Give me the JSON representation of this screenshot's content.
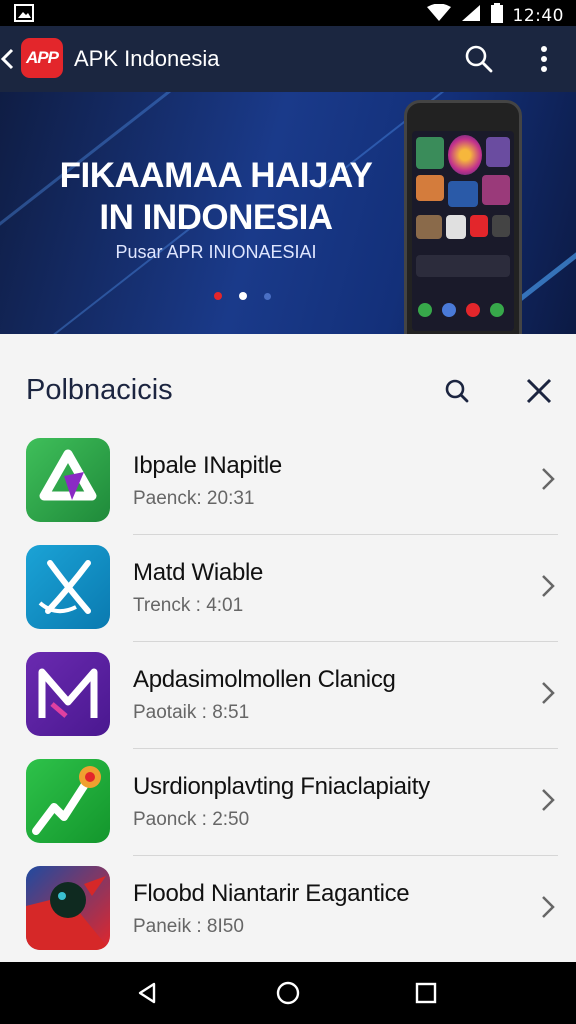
{
  "status_bar": {
    "time": "12:40"
  },
  "app_bar": {
    "logo_text": "APP",
    "title": "APK Indonesia"
  },
  "banner": {
    "headline_line1": "FIKAAMAA HAIJAY",
    "headline_line2": "IN INDONESIA",
    "subtitle": "Pusar APR INIONAESIAI",
    "slides": 3,
    "active_slide": 2
  },
  "list": {
    "heading": "Polbnacicis",
    "items": [
      {
        "name": "Ibpale INapitle",
        "meta": "Paenck: 20:31",
        "icon": "green-arrow-app-icon"
      },
      {
        "name": "Matd Wiable",
        "meta": "Trenck : 4:01",
        "icon": "blue-x-app-icon"
      },
      {
        "name": "Apdasimolmollen Clanicg",
        "meta": "Paotaik : 8:51",
        "icon": "purple-m-app-icon"
      },
      {
        "name": "Usrdionplavting Fniaclapiaity",
        "meta": "Paonck : 2:50",
        "icon": "green-chart-app-icon"
      },
      {
        "name": "Floobd Niantarir Eagantice",
        "meta": "Paneik : 8I50",
        "icon": "red-bird-app-icon"
      }
    ]
  },
  "colors": {
    "app_bar": "#1b2640",
    "accent_red": "#e3262b",
    "banner": "#1a3a8a"
  }
}
